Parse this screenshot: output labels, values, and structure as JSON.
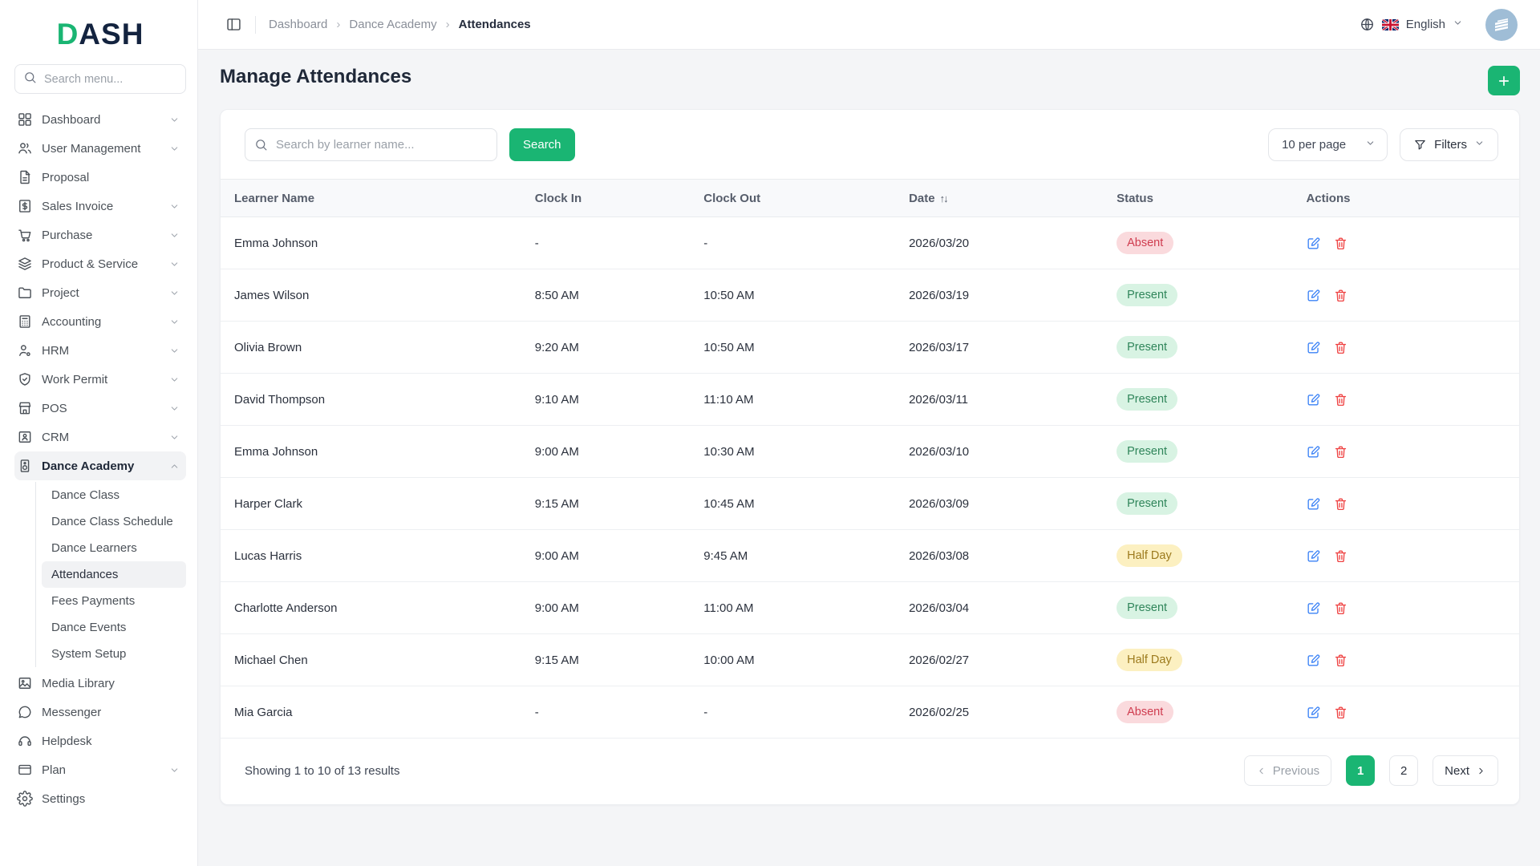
{
  "brand": {
    "logo_first": "D",
    "logo_rest": "ASH"
  },
  "colors": {
    "accent": "#1ab573",
    "present_bg": "#d8f3e3",
    "present_text": "#2f855a",
    "absent_bg": "#fadadd",
    "absent_text": "#cf3c4f",
    "half_day_bg": "#fcf0c1",
    "half_day_text": "#9c7a1d"
  },
  "sidebar": {
    "search_placeholder": "Search menu...",
    "items": [
      {
        "label": "Dashboard"
      },
      {
        "label": "User Management"
      },
      {
        "label": "Proposal"
      },
      {
        "label": "Sales Invoice"
      },
      {
        "label": "Purchase"
      },
      {
        "label": "Product & Service"
      },
      {
        "label": "Project"
      },
      {
        "label": "Accounting"
      },
      {
        "label": "HRM"
      },
      {
        "label": "Work Permit"
      },
      {
        "label": "POS"
      },
      {
        "label": "CRM"
      },
      {
        "label": "Dance Academy"
      },
      {
        "label": "Media Library"
      },
      {
        "label": "Messenger"
      },
      {
        "label": "Helpdesk"
      },
      {
        "label": "Plan"
      },
      {
        "label": "Settings"
      }
    ],
    "dance_academy_submenu": [
      {
        "label": "Dance Class"
      },
      {
        "label": "Dance Class Schedule"
      },
      {
        "label": "Dance Learners"
      },
      {
        "label": "Attendances"
      },
      {
        "label": "Fees Payments"
      },
      {
        "label": "Dance Events"
      },
      {
        "label": "System Setup"
      }
    ]
  },
  "header": {
    "breadcrumb": {
      "items": [
        "Dashboard",
        "Dance Academy",
        "Attendances"
      ]
    },
    "language": "English"
  },
  "page": {
    "title": "Manage Attendances"
  },
  "toolbar": {
    "search_placeholder": "Search by learner name...",
    "search_button": "Search",
    "per_page": "10 per page",
    "filters_button": "Filters"
  },
  "table": {
    "columns": [
      "Learner Name",
      "Clock In",
      "Clock Out",
      "Date",
      "Status",
      "Actions"
    ],
    "rows": [
      {
        "name": "Emma Johnson",
        "clock_in": "-",
        "clock_out": "-",
        "date": "2026/03/20",
        "status": "Absent"
      },
      {
        "name": "James Wilson",
        "clock_in": "8:50 AM",
        "clock_out": "10:50 AM",
        "date": "2026/03/19",
        "status": "Present"
      },
      {
        "name": "Olivia Brown",
        "clock_in": "9:20 AM",
        "clock_out": "10:50 AM",
        "date": "2026/03/17",
        "status": "Present"
      },
      {
        "name": "David Thompson",
        "clock_in": "9:10 AM",
        "clock_out": "11:10 AM",
        "date": "2026/03/11",
        "status": "Present"
      },
      {
        "name": "Emma Johnson",
        "clock_in": "9:00 AM",
        "clock_out": "10:30 AM",
        "date": "2026/03/10",
        "status": "Present"
      },
      {
        "name": "Harper Clark",
        "clock_in": "9:15 AM",
        "clock_out": "10:45 AM",
        "date": "2026/03/09",
        "status": "Present"
      },
      {
        "name": "Lucas Harris",
        "clock_in": "9:00 AM",
        "clock_out": "9:45 AM",
        "date": "2026/03/08",
        "status": "Half Day"
      },
      {
        "name": "Charlotte Anderson",
        "clock_in": "9:00 AM",
        "clock_out": "11:00 AM",
        "date": "2026/03/04",
        "status": "Present"
      },
      {
        "name": "Michael Chen",
        "clock_in": "9:15 AM",
        "clock_out": "10:00 AM",
        "date": "2026/02/27",
        "status": "Half Day"
      },
      {
        "name": "Mia Garcia",
        "clock_in": "-",
        "clock_out": "-",
        "date": "2026/02/25",
        "status": "Absent"
      }
    ]
  },
  "pagination": {
    "summary": "Showing 1 to 10 of 13 results",
    "previous": "Previous",
    "pages": [
      "1",
      "2"
    ],
    "active_page": "1",
    "next": "Next"
  }
}
